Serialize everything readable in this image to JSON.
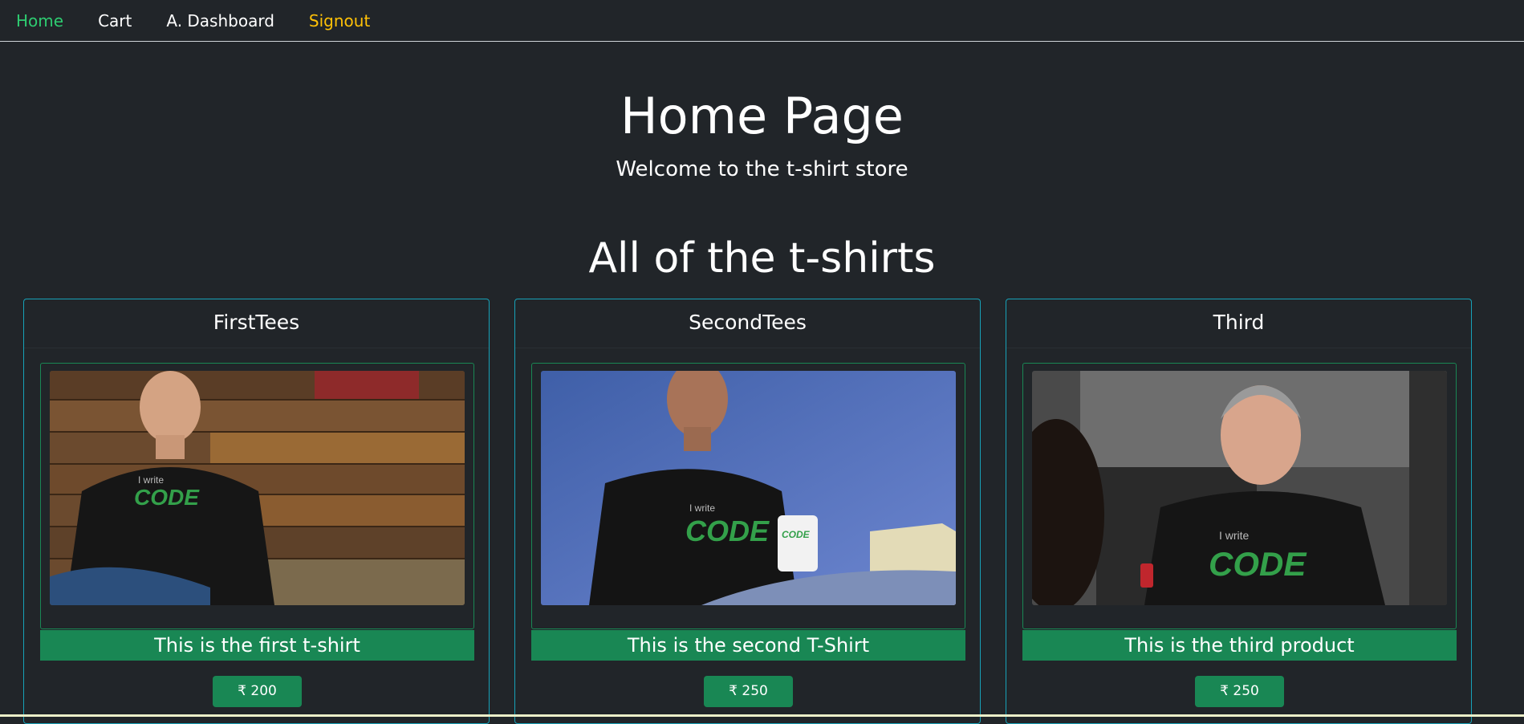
{
  "nav": {
    "home": "Home",
    "cart": "Cart",
    "dashboard": "A. Dashboard",
    "signout": "Signout"
  },
  "jumbotron": {
    "title": "Home Page",
    "subtitle": "Welcome to the t-shirt store"
  },
  "section_title": "All of the t-shirts",
  "products": [
    {
      "name": "FirstTees",
      "description": "This is the first t-shirt",
      "price": "₹ 200",
      "image": "man-wearing-i-write-code-tshirt-wood-wall"
    },
    {
      "name": "SecondTees",
      "description": "This is the second T-Shirt",
      "price": "₹ 250",
      "image": "man-wearing-i-write-code-tshirt-holding-mug"
    },
    {
      "name": "Third",
      "description": "This is the third product",
      "price": "₹ 250",
      "image": "smiling-man-wearing-i-write-code-tshirt"
    }
  ],
  "colors": {
    "background": "#212529",
    "active_link": "#2ecc71",
    "signout_link": "#ffc107",
    "card_border": "#17a2b8",
    "success": "#198754"
  }
}
